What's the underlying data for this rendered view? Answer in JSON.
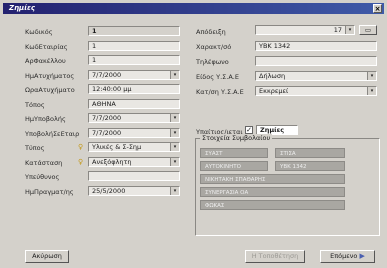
{
  "window": {
    "title": "Ζημίες",
    "close": "×"
  },
  "left": [
    {
      "label": "Κωδικός",
      "value": "1",
      "dropdown": false,
      "bulb": false,
      "bold": true
    },
    {
      "label": "ΚωδΕταιρίας",
      "value": "1",
      "dropdown": false,
      "bulb": false
    },
    {
      "label": "ΑρΦακέλλου",
      "value": "1",
      "dropdown": false,
      "bulb": false
    },
    {
      "label": "ΗμΑτυχήματος",
      "value": "7/7/2000",
      "dropdown": true,
      "bulb": false
    },
    {
      "label": "ΩραΑτυχήματο",
      "value": "12:40:00 μμ",
      "dropdown": false,
      "bulb": false
    },
    {
      "label": "Τόπος",
      "value": "ΑΘΗΝΑ",
      "dropdown": false,
      "bulb": false
    },
    {
      "label": "ΗμΥποβολής",
      "value": "7/7/2000",
      "dropdown": true,
      "bulb": false
    },
    {
      "label": "ΥποβολήΣεΕταιρ",
      "value": "7/7/2000",
      "dropdown": true,
      "bulb": false
    },
    {
      "label": "Τύπος",
      "value": "Υλικές & Σ-Σημ",
      "dropdown": true,
      "bulb": true
    },
    {
      "label": "Κατάσταση",
      "value": "Ανεξόφλητη",
      "dropdown": true,
      "bulb": true
    },
    {
      "label": "Υπεύθυνος",
      "value": "",
      "dropdown": false,
      "bulb": false
    },
    {
      "label": "ΗμΠραγματ/ης",
      "value": "25/5/2000",
      "dropdown": true,
      "bulb": false
    }
  ],
  "right": {
    "apodeixi": {
      "label": "Απόδειξη",
      "value": "17"
    },
    "fields": [
      {
        "label": "Χαρακτ/σό",
        "value": "YBK 1342",
        "dropdown": false
      },
      {
        "label": "Τηλέφωνο",
        "value": "",
        "dropdown": false
      },
      {
        "label": "Είδος Υ.Σ.Α.Ε",
        "value": "Δήλωση",
        "dropdown": true
      },
      {
        "label": "Κατ/ση Υ.Σ.Α.Ε",
        "value": "Εκκρεμεί",
        "dropdown": true
      }
    ],
    "liable": {
      "label": "Υπαίτιος/ιεται",
      "checked": "✓",
      "value": "Ζημίες"
    }
  },
  "group": {
    "title": "Στοιχεία Συμβολαίου",
    "rows": [
      [
        "ΣΥΑΣΤ",
        "ΣΤΙΣΑ"
      ],
      [
        "ΑΥΤΟΚΙΝΗΤΟ",
        "YBK 1342"
      ],
      [
        "ΝΙΚΗΤΑΚΗ ΣΠΑΘΑΡΗΣ"
      ],
      [
        "ΣΥΝΕΡΓΑΣΙΑ ΟΑ"
      ],
      [
        "ΦΩΚΑΣ"
      ]
    ]
  },
  "buttons": {
    "cancel": "Ακύρωση",
    "delete": "Η Τοποθέτηση",
    "next": "Επόμενο"
  },
  "icons": {
    "dropdown": "▾",
    "bulb": "💡",
    "next": "▭"
  }
}
